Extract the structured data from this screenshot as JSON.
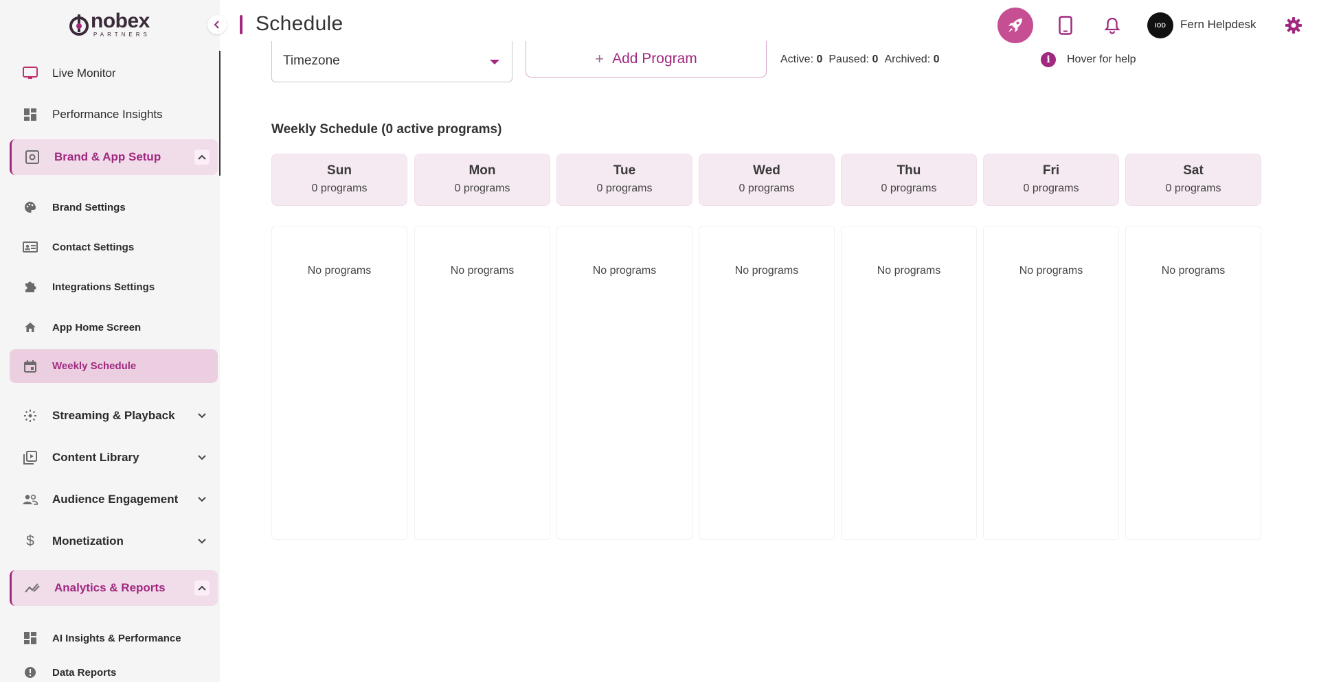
{
  "brand": {
    "logo_word": "nobex",
    "logo_sub": "PARTNERS",
    "accent": "#a0297f",
    "rocket_bg": "#c64f93"
  },
  "header": {
    "title": "Schedule",
    "user_name": "Fern Helpdesk",
    "avatar_text": "IOD"
  },
  "sidebar": {
    "items": [
      {
        "label": "Live Monitor",
        "icon": "monitor-icon"
      },
      {
        "label": "Performance Insights",
        "icon": "dashboard-icon"
      },
      {
        "label": "Brand & App Setup",
        "icon": "settings-box-icon"
      },
      {
        "label": "Brand Settings",
        "icon": "palette-icon"
      },
      {
        "label": "Contact Settings",
        "icon": "contact-card-icon"
      },
      {
        "label": "Integrations Settings",
        "icon": "puzzle-icon"
      },
      {
        "label": "App Home Screen",
        "icon": "home-icon"
      },
      {
        "label": "Weekly Schedule",
        "icon": "calendar-icon"
      },
      {
        "label": "Streaming & Playback",
        "icon": "streaming-icon"
      },
      {
        "label": "Content Library",
        "icon": "library-icon"
      },
      {
        "label": "Audience Engagement",
        "icon": "people-icon"
      },
      {
        "label": "Monetization",
        "icon": "dollar-icon"
      },
      {
        "label": "Analytics & Reports",
        "icon": "analytics-icon"
      },
      {
        "label": "AI Insights & Performance",
        "icon": "dashboard-icon"
      },
      {
        "label": "Data Reports",
        "icon": "alert-circle-icon"
      }
    ]
  },
  "controls": {
    "timezone_label": "Timezone",
    "add_program_label": "Add Program",
    "stats": {
      "active_label": "Active:",
      "active": "0",
      "paused_label": "Paused:",
      "paused": "0",
      "archived_label": "Archived:",
      "archived": "0"
    },
    "help_text": "Hover for help"
  },
  "schedule": {
    "title": "Weekly Schedule (0 active programs)",
    "empty_text": "No programs",
    "days": [
      {
        "name": "Sun",
        "count": "0 programs"
      },
      {
        "name": "Mon",
        "count": "0 programs"
      },
      {
        "name": "Tue",
        "count": "0 programs"
      },
      {
        "name": "Wed",
        "count": "0 programs"
      },
      {
        "name": "Thu",
        "count": "0 programs"
      },
      {
        "name": "Fri",
        "count": "0 programs"
      },
      {
        "name": "Sat",
        "count": "0 programs"
      }
    ]
  }
}
